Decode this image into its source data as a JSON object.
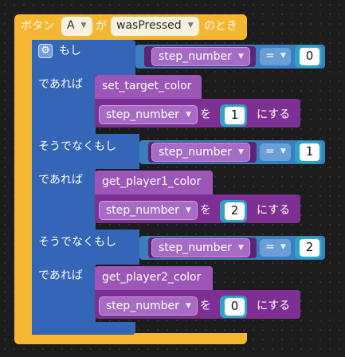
{
  "event": {
    "prefix": "ボタン",
    "button": "A",
    "particle": "が",
    "state": "wasPressed",
    "suffix": "のとき"
  },
  "if_block": {
    "if_label": "もし",
    "then_label": "であれば",
    "elseif_label": "そうでなくもし"
  },
  "conditions": [
    {
      "variable": "step_number",
      "operator": "=",
      "value": "0"
    },
    {
      "variable": "step_number",
      "operator": "=",
      "value": "1"
    },
    {
      "variable": "step_number",
      "operator": "=",
      "value": "2"
    }
  ],
  "functions": [
    {
      "name": "set_target_color",
      "variable": "step_number",
      "to_label": "を",
      "value": "1",
      "action": "にする"
    },
    {
      "name": "get_player1_color",
      "variable": "step_number",
      "to_label": "を",
      "value": "2",
      "action": "にする"
    },
    {
      "name": "get_player2_color",
      "variable": "step_number",
      "to_label": "を",
      "value": "0",
      "action": "にする"
    }
  ],
  "icons": {
    "gear": "gear-icon",
    "caret": "chevron-down-icon"
  }
}
